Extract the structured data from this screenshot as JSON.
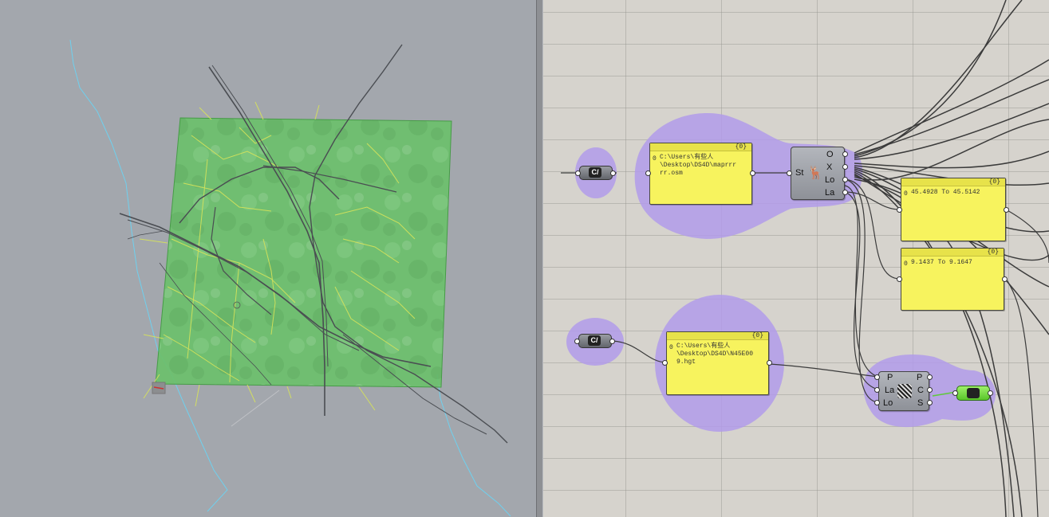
{
  "colors": {
    "viewport_bg": "#a3a7ad",
    "canvas_bg": "#d6d3cd",
    "terrain_fill": "#6cc06c",
    "road_yellow": "#d7e35a",
    "water_blue": "#6fd0ee",
    "group_purple": "#b19bea",
    "panel_yellow": "#f7f35e",
    "toggle_green": "#7de03c"
  },
  "canvas": {
    "file_path_1": {
      "header": "{0}",
      "index": "0",
      "text": "C:\\Users\\有些人\n\\Desktop\\DS4D\\maprrr\nrr.osm"
    },
    "file_path_2": {
      "header": "{0}",
      "index": "0",
      "text": "C:\\Users\\有些人\n\\Desktop\\DS4D\\N45E00\n9.hgt"
    },
    "range_1": {
      "header": "{0}",
      "index": "0",
      "text": "45.4928 To 45.5142"
    },
    "range_2": {
      "header": "{0}",
      "index": "0",
      "text": "9.1437 To 9.1647"
    },
    "osm_component": {
      "input": "St",
      "outputs": [
        "O",
        "X",
        "Lo",
        "La"
      ],
      "icon": "elk-osm-icon"
    },
    "topo_component": {
      "inputs": [
        "P",
        "La",
        "Lo"
      ],
      "outputs": [
        "P",
        "C",
        "S"
      ],
      "icon": "topography-icon"
    },
    "file_param_icon": "file-path-icon",
    "file_param_label": "C/",
    "toggle_icon": "mesh-preview-icon"
  }
}
